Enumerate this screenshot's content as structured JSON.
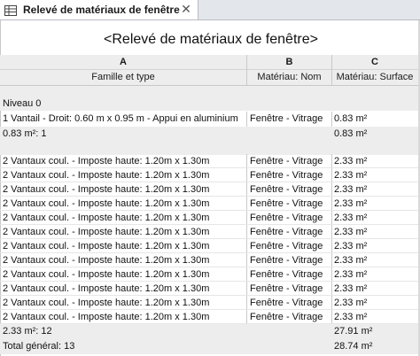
{
  "tab": {
    "title": "Relevé de matériaux de fenêtre",
    "close_glyph": "✕",
    "icon": "schedule-table-icon"
  },
  "schedule": {
    "title": "<Relevé de matériaux de fenêtre>",
    "columns": [
      {
        "letter": "A",
        "name": "Famille et type"
      },
      {
        "letter": "B",
        "name": "Matériau: Nom"
      },
      {
        "letter": "C",
        "name": "Matériau: Surface"
      }
    ],
    "group_header": "Niveau 0",
    "group1": {
      "row": {
        "a": "1 Vantail - Droit: 0.60 m x 0.95 m - Appui en aluminium",
        "b": "Fenêtre - Vitrage",
        "c": "0.83 m²"
      },
      "subtotal": {
        "a": "0.83 m²: 1",
        "c": "0.83 m²"
      }
    },
    "group2": {
      "rows": [
        {
          "a": "2 Vantaux coul. - Imposte haute: 1.20m x 1.30m",
          "b": "Fenêtre - Vitrage",
          "c": "2.33 m²"
        },
        {
          "a": "2 Vantaux coul. - Imposte haute: 1.20m x 1.30m",
          "b": "Fenêtre - Vitrage",
          "c": "2.33 m²"
        },
        {
          "a": "2 Vantaux coul. - Imposte haute: 1.20m x 1.30m",
          "b": "Fenêtre - Vitrage",
          "c": "2.33 m²"
        },
        {
          "a": "2 Vantaux coul. - Imposte haute: 1.20m x 1.30m",
          "b": "Fenêtre - Vitrage",
          "c": "2.33 m²"
        },
        {
          "a": "2 Vantaux coul. - Imposte haute: 1.20m x 1.30m",
          "b": "Fenêtre - Vitrage",
          "c": "2.33 m²"
        },
        {
          "a": "2 Vantaux coul. - Imposte haute: 1.20m x 1.30m",
          "b": "Fenêtre - Vitrage",
          "c": "2.33 m²"
        },
        {
          "a": "2 Vantaux coul. - Imposte haute: 1.20m x 1.30m",
          "b": "Fenêtre - Vitrage",
          "c": "2.33 m²"
        },
        {
          "a": "2 Vantaux coul. - Imposte haute: 1.20m x 1.30m",
          "b": "Fenêtre - Vitrage",
          "c": "2.33 m²"
        },
        {
          "a": "2 Vantaux coul. - Imposte haute: 1.20m x 1.30m",
          "b": "Fenêtre - Vitrage",
          "c": "2.33 m²"
        },
        {
          "a": "2 Vantaux coul. - Imposte haute: 1.20m x 1.30m",
          "b": "Fenêtre - Vitrage",
          "c": "2.33 m²"
        },
        {
          "a": "2 Vantaux coul. - Imposte haute: 1.20m x 1.30m",
          "b": "Fenêtre - Vitrage",
          "c": "2.33 m²"
        },
        {
          "a": "2 Vantaux coul. - Imposte haute: 1.20m x 1.30m",
          "b": "Fenêtre - Vitrage",
          "c": "2.33 m²"
        }
      ],
      "subtotal": {
        "a": "2.33 m²: 12",
        "c": "27.91 m²"
      }
    },
    "grand_total": {
      "a": "Total général: 13",
      "c": "28.74 m²"
    }
  }
}
